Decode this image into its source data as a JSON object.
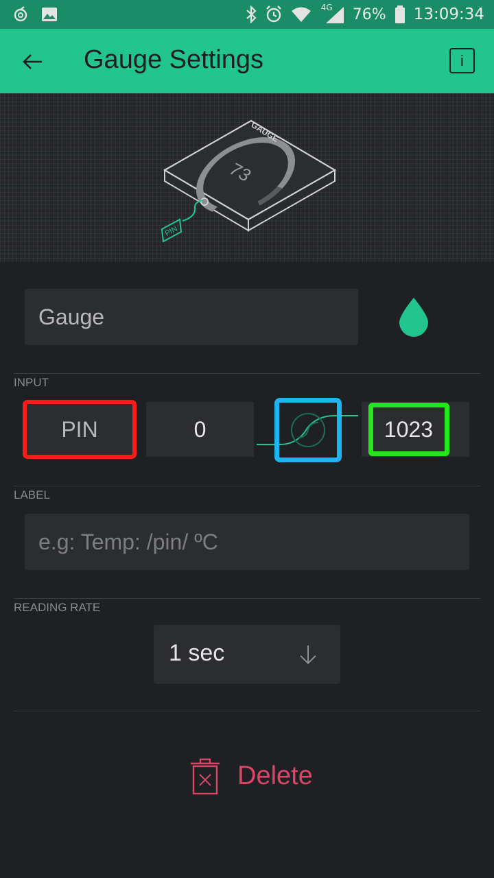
{
  "status_bar": {
    "signal_label": "4G",
    "battery": "76%",
    "time": "13:09:34"
  },
  "app_bar": {
    "title": "Gauge Settings"
  },
  "preview": {
    "widget_label": "GAUGE",
    "widget_value": "73",
    "pin_tag": "PIN"
  },
  "name_field": {
    "value": "Gauge"
  },
  "input_section": {
    "label": "INPUT",
    "pin_label": "PIN",
    "min_value": "0",
    "max_value": "1023"
  },
  "label_section": {
    "label": "LABEL",
    "placeholder": "e.g: Temp: /pin/ ºC"
  },
  "reading_rate": {
    "label": "READING RATE",
    "selected": "1 sec"
  },
  "delete": {
    "label": "Delete"
  },
  "colors": {
    "accent": "#22c58e",
    "status_bar": "#1a8d68",
    "background": "#1f2024",
    "danger": "#d94668"
  }
}
